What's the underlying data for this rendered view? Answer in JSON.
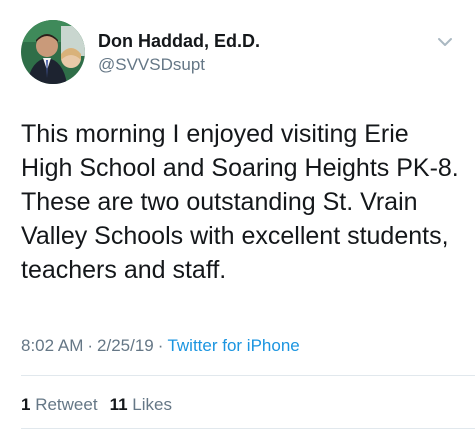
{
  "tweet": {
    "author": {
      "name": "Don Haddad, Ed.D.",
      "handle": "@SVVSDsupt",
      "avatar_icon": "profile-photo"
    },
    "menu_icon": "chevron-down-icon",
    "text": "This morning I enjoyed visiting Erie High School and Soaring Heights PK-8. These are two outstanding St. Vrain Valley Schools with excellent students, teachers and staff.",
    "time": "8:02 AM",
    "separator": "·",
    "date": "2/25/19",
    "source": "Twitter for iPhone",
    "stats": {
      "retweets_count": "1",
      "retweets_label": "Retweet",
      "likes_count": "11",
      "likes_label": "Likes"
    }
  },
  "colors": {
    "text": "#14171a",
    "secondary": "#657786",
    "link": "#1b95e0",
    "divider": "#e1e8ed"
  }
}
